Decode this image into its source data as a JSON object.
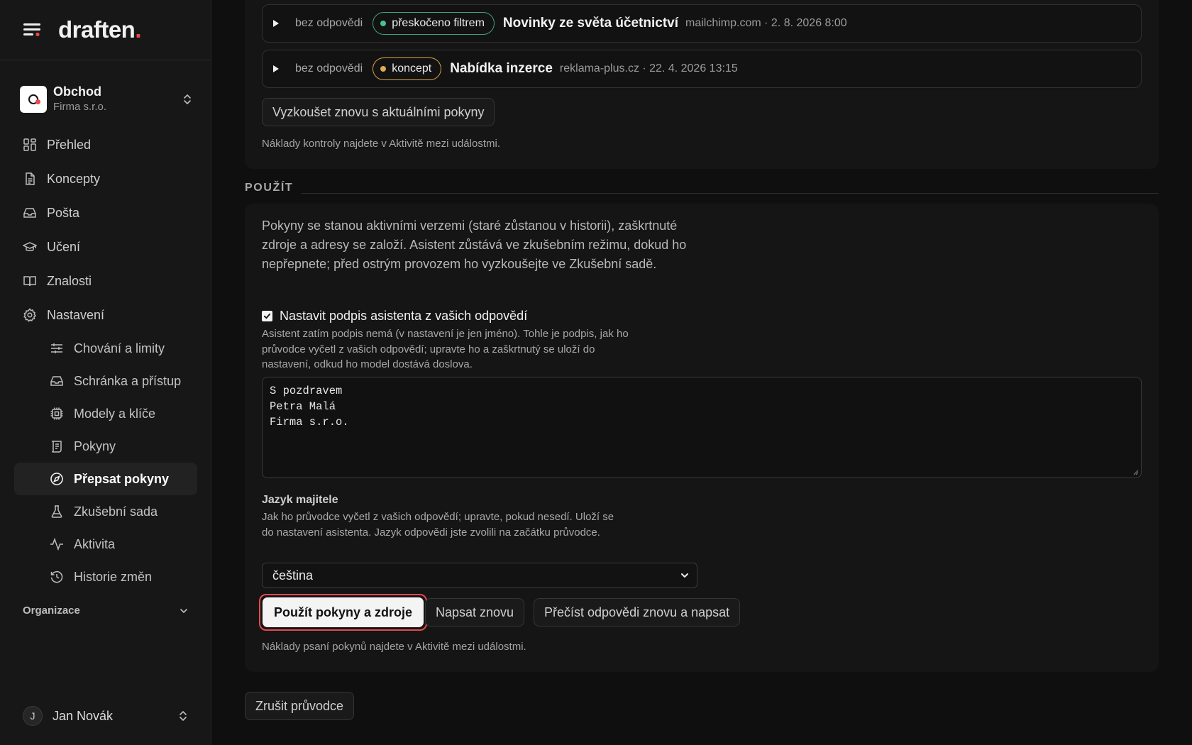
{
  "brand": {
    "logo_text": "draften",
    "logo_dot": ".",
    "accent": "#e5484d"
  },
  "org": {
    "name": "Obchod",
    "company": "Firma s.r.o."
  },
  "nav": [
    {
      "label": "Přehled",
      "icon": "dashboard-icon"
    },
    {
      "label": "Koncepty",
      "icon": "document-icon"
    },
    {
      "label": "Pošta",
      "icon": "inbox-icon"
    },
    {
      "label": "Učení",
      "icon": "graduation-cap-icon"
    },
    {
      "label": "Znalosti",
      "icon": "book-icon"
    },
    {
      "label": "Nastavení",
      "icon": "gear-icon"
    }
  ],
  "subnav": [
    {
      "label": "Chování a limity",
      "icon": "sliders-icon"
    },
    {
      "label": "Schránka a přístup",
      "icon": "inbox-icon"
    },
    {
      "label": "Modely a klíče",
      "icon": "chip-icon"
    },
    {
      "label": "Pokyny",
      "icon": "scroll-icon"
    },
    {
      "label": "Přepsat pokyny",
      "icon": "compass-icon",
      "active": true
    },
    {
      "label": "Zkušební sada",
      "icon": "flask-icon"
    },
    {
      "label": "Aktivita",
      "icon": "activity-icon"
    },
    {
      "label": "Historie změn",
      "icon": "history-icon"
    }
  ],
  "organization_section": {
    "label": "Organizace"
  },
  "user": {
    "initial": "J",
    "name": "Jan Novák"
  },
  "messages": [
    {
      "state": "bez odpovědi",
      "badge": "přeskočeno filtrem",
      "badge_color": "#47c28e",
      "subject": "Novinky ze světa účetnictví",
      "meta": "mailchimp.com · 2. 8. 2026 8:00"
    },
    {
      "state": "bez odpovědi",
      "badge": "koncept",
      "badge_color": "#e3a94e",
      "subject": "Nabídka inzerce",
      "meta": "reklama-plus.cz · 22. 4. 2026 13:15"
    }
  ],
  "retry": {
    "button_label": "Vyzkoušet znovu s aktuálními pokyny",
    "note": "Náklady kontroly najdete v Aktivitě mezi událostmi."
  },
  "apply": {
    "section_label": "POUŽÍT",
    "description": "Pokyny se stanou aktivními verzemi (staré zůstanou v historii), zaškrtnuté zdroje a adresy se založí. Asistent zůstává ve zkušebním režimu, dokud ho nepřepnete; před ostrým provozem ho vyzkoušejte ve Zkušební sadě.",
    "signature_checkbox_label": "Nastavit podpis asistenta z vašich odpovědí",
    "signature_checked": true,
    "signature_help": "Asistent zatím podpis nemá (v nastavení je jen jméno). Tohle je podpis, jak ho průvodce vyčetl z vašich odpovědí; upravte ho a zaškrtnutý se uloží do nastavení, odkud ho model dostává doslova.",
    "signature_lines": [
      "S pozdravem",
      "Petra Malá",
      "Firma s.r.o."
    ],
    "language_label": "Jazyk majitele",
    "language_help": "Jak ho průvodce vyčetl z vašich odpovědí; upravte, pokud nesedí. Uloží se do nastavení asistenta. Jazyk odpovědi jste zvolili na začátku průvodce.",
    "language_value": "čeština",
    "primary_button": "Použít pokyny a zdroje",
    "rewrite_button": "Napsat znovu",
    "reread_button": "Přečíst odpovědi znovu a napsat",
    "cost_note": "Náklady psaní pokynů najdete v Aktivitě mezi událostmi."
  },
  "cancel_button": "Zrušit průvodce"
}
